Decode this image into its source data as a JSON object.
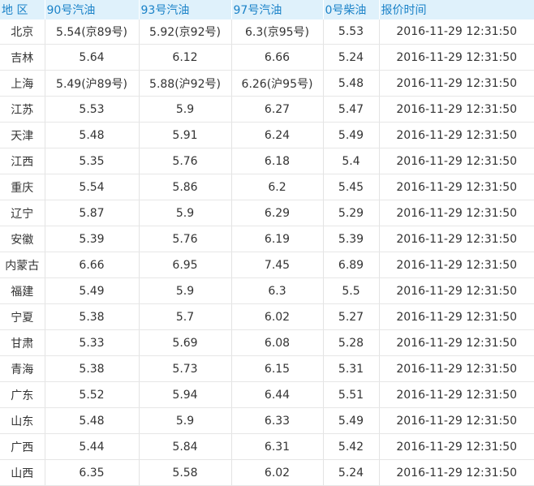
{
  "headers": [
    "地 区",
    "90号汽油",
    "93号汽油",
    "97号汽油",
    "0号柴油",
    "报价时间"
  ],
  "rows": [
    {
      "region": "北京",
      "p90": "5.54(京89号)",
      "p93": "5.92(京92号)",
      "p97": "6.3(京95号)",
      "p0": "5.53",
      "time": "2016-11-29 12:31:50"
    },
    {
      "region": "吉林",
      "p90": "5.64",
      "p93": "6.12",
      "p97": "6.66",
      "p0": "5.24",
      "time": "2016-11-29 12:31:50"
    },
    {
      "region": "上海",
      "p90": "5.49(沪89号)",
      "p93": "5.88(沪92号)",
      "p97": "6.26(沪95号)",
      "p0": "5.48",
      "time": "2016-11-29 12:31:50"
    },
    {
      "region": "江苏",
      "p90": "5.53",
      "p93": "5.9",
      "p97": "6.27",
      "p0": "5.47",
      "time": "2016-11-29 12:31:50"
    },
    {
      "region": "天津",
      "p90": "5.48",
      "p93": "5.91",
      "p97": "6.24",
      "p0": "5.49",
      "time": "2016-11-29 12:31:50"
    },
    {
      "region": "江西",
      "p90": "5.35",
      "p93": "5.76",
      "p97": "6.18",
      "p0": "5.4",
      "time": "2016-11-29 12:31:50"
    },
    {
      "region": "重庆",
      "p90": "5.54",
      "p93": "5.86",
      "p97": "6.2",
      "p0": "5.45",
      "time": "2016-11-29 12:31:50"
    },
    {
      "region": "辽宁",
      "p90": "5.87",
      "p93": "5.9",
      "p97": "6.29",
      "p0": "5.29",
      "time": "2016-11-29 12:31:50"
    },
    {
      "region": "安徽",
      "p90": "5.39",
      "p93": "5.76",
      "p97": "6.19",
      "p0": "5.39",
      "time": "2016-11-29 12:31:50"
    },
    {
      "region": "内蒙古",
      "p90": "6.66",
      "p93": "6.95",
      "p97": "7.45",
      "p0": "6.89",
      "time": "2016-11-29 12:31:50"
    },
    {
      "region": "福建",
      "p90": "5.49",
      "p93": "5.9",
      "p97": "6.3",
      "p0": "5.5",
      "time": "2016-11-29 12:31:50"
    },
    {
      "region": "宁夏",
      "p90": "5.38",
      "p93": "5.7",
      "p97": "6.02",
      "p0": "5.27",
      "time": "2016-11-29 12:31:50"
    },
    {
      "region": "甘肃",
      "p90": "5.33",
      "p93": "5.69",
      "p97": "6.08",
      "p0": "5.28",
      "time": "2016-11-29 12:31:50"
    },
    {
      "region": "青海",
      "p90": "5.38",
      "p93": "5.73",
      "p97": "6.15",
      "p0": "5.31",
      "time": "2016-11-29 12:31:50"
    },
    {
      "region": "广东",
      "p90": "5.52",
      "p93": "5.94",
      "p97": "6.44",
      "p0": "5.51",
      "time": "2016-11-29 12:31:50"
    },
    {
      "region": "山东",
      "p90": "5.48",
      "p93": "5.9",
      "p97": "6.33",
      "p0": "5.49",
      "time": "2016-11-29 12:31:50"
    },
    {
      "region": "广西",
      "p90": "5.44",
      "p93": "5.84",
      "p97": "6.31",
      "p0": "5.42",
      "time": "2016-11-29 12:31:50"
    },
    {
      "region": "山西",
      "p90": "6.35",
      "p93": "5.58",
      "p97": "6.02",
      "p0": "5.24",
      "time": "2016-11-29 12:31:50"
    }
  ],
  "colors": {
    "header_background": "#dff1fb",
    "header_text": "#1a82c8",
    "cell_text": "#333333",
    "grid_line": "#e3e3e3"
  }
}
